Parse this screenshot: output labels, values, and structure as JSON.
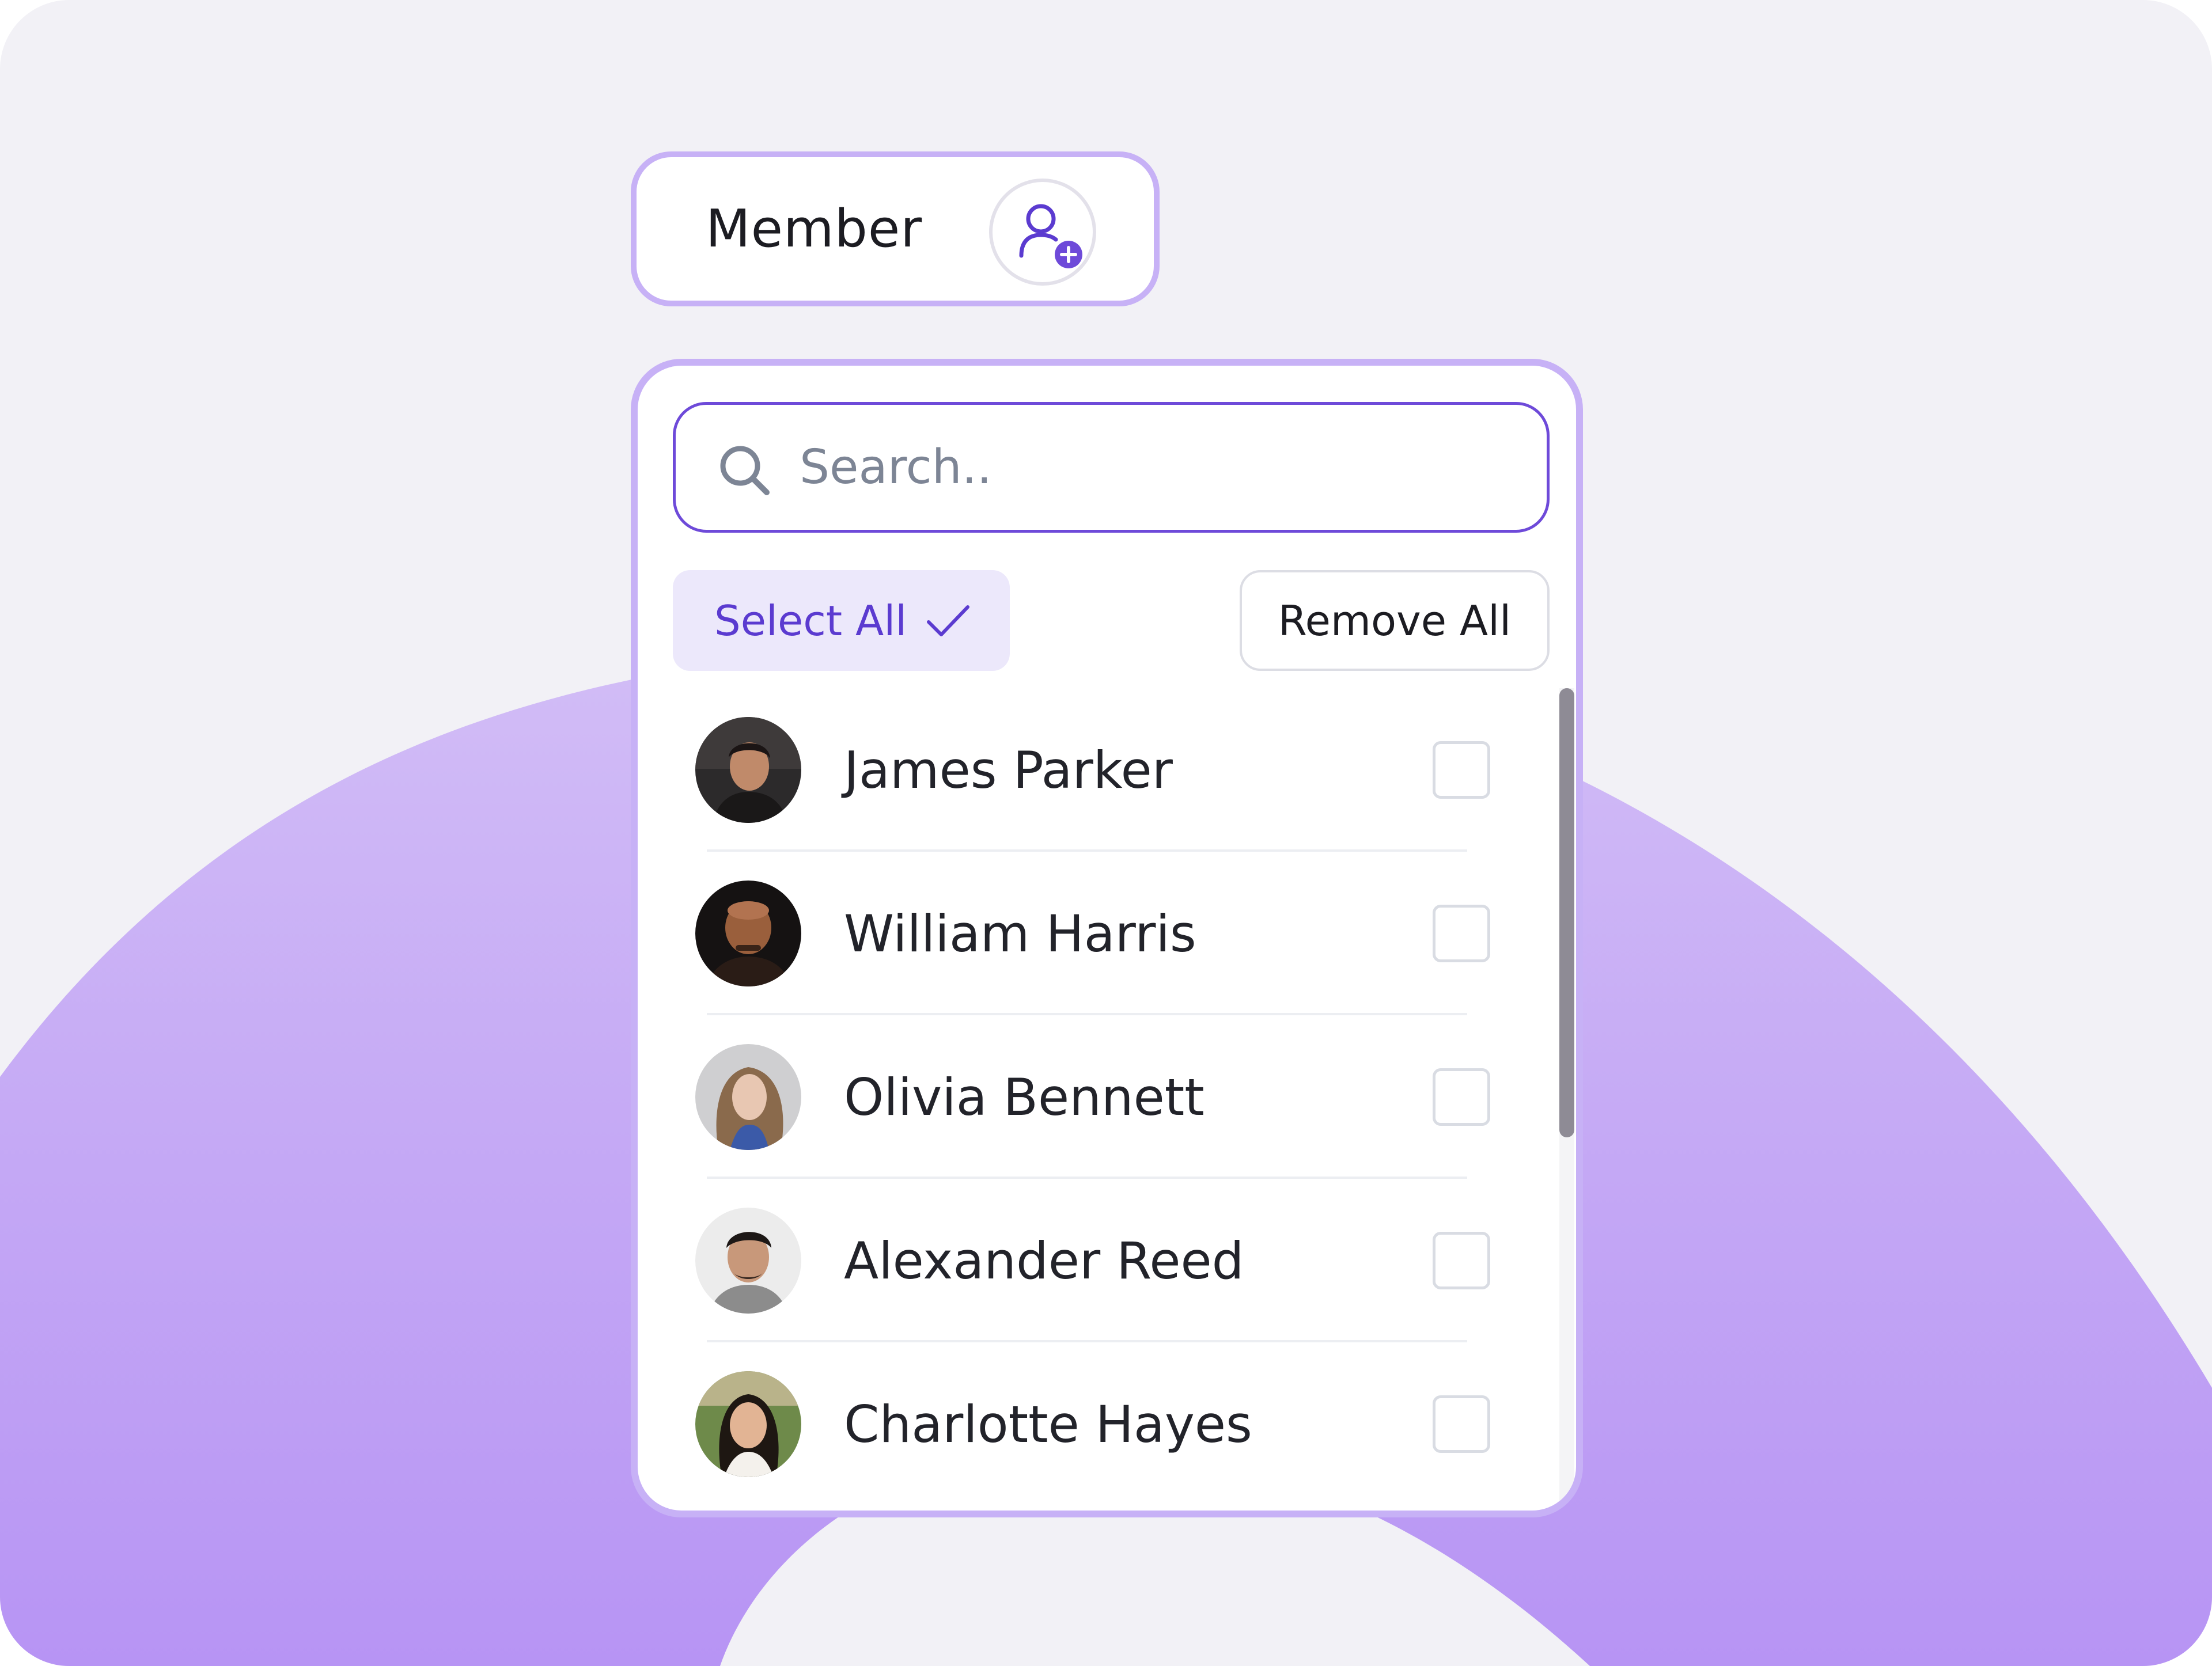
{
  "colors": {
    "accent": "#6e4ad9",
    "accent_light": "#ece8fb",
    "panel_border": "#c7b1f6",
    "background": "#f2f1f6",
    "arc_top": "#d2bdf6",
    "arc_bottom": "#b794f4"
  },
  "member": {
    "label": "Member",
    "add_icon": "user-add-icon"
  },
  "search": {
    "placeholder": "Search..",
    "icon": "search-icon"
  },
  "actions": {
    "select_all": "Select All",
    "select_all_icon": "check-icon",
    "remove_all": "Remove All"
  },
  "members": [
    {
      "name": "James Parker",
      "checked": false
    },
    {
      "name": "William Harris",
      "checked": false
    },
    {
      "name": "Olivia Bennett",
      "checked": false
    },
    {
      "name": "Alexander Reed",
      "checked": false
    },
    {
      "name": "Charlotte Hayes",
      "checked": false
    }
  ],
  "scroll": {
    "thumb_fraction": 0.54,
    "position": 0
  }
}
